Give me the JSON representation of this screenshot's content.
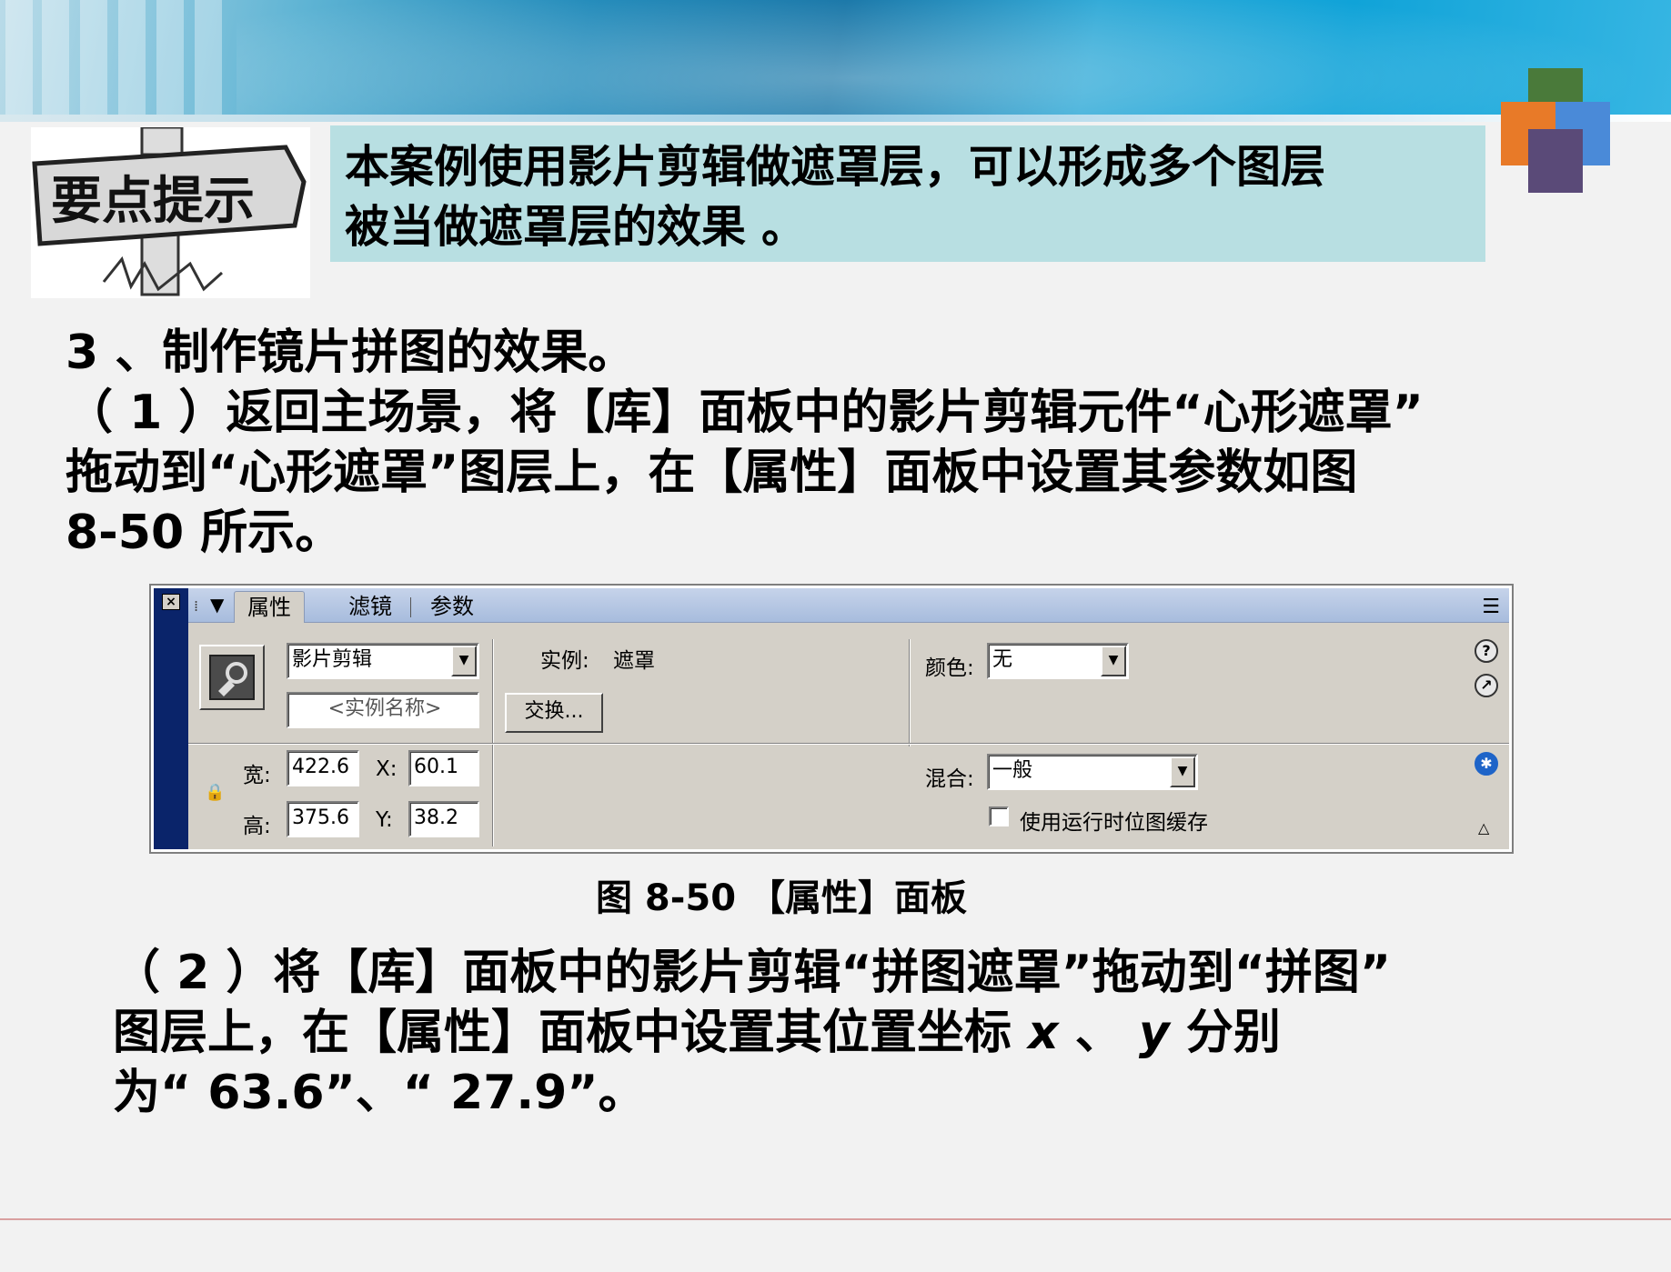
{
  "colors": {
    "tip_box_bg": "#b8dfe2",
    "page_bg": "#f2f2f2",
    "panel_bg": "#d4d0c8",
    "panel_side": "#0a246a",
    "footer_rule": "#d9a0a0"
  },
  "tip": {
    "sign_text": "要点提示",
    "lines": [
      "本案例使用影片剪辑做遮罩层，可以形成多个图层",
      "被当做遮罩层的效果 。"
    ]
  },
  "step": {
    "heading": "3 、制作镜片拼图的效果。",
    "item1_lines": [
      "（ 1 ）返回主场景，将【库】面板中的影片剪辑元件“心形遮罩”",
      "拖动到“心形遮罩”图层上，在【属性】面板中设置其参数如图",
      "8-50 所示。"
    ],
    "item2_lines": {
      "line1": "（ 2 ）将【库】面板中的影片剪辑“拼图遮罩”拖动到“拼图”",
      "line2_pre": "图层上，在【属性】面板中设置其位置坐标 ",
      "line2_x": "x",
      "line2_mid": " 、 ",
      "line2_y": "y",
      "line2_post": " 分别",
      "line3": "为“ 63.6”、“ 27.9”。"
    }
  },
  "panel": {
    "close_glyph": "×",
    "grip_glyph": "⁞",
    "collapse_glyph": "▼",
    "tabs": [
      {
        "label": "属性"
      },
      {
        "label": "滤镜"
      },
      {
        "label": "参数"
      }
    ],
    "options_glyph": "☰",
    "symbol_type": "影片剪辑",
    "instance_name_placeholder": "<实例名称>",
    "instance_label": "实例:",
    "instance_value": "遮罩",
    "swap_button": "交换...",
    "color_label": "颜色:",
    "color_value": "无",
    "blend_label": "混合:",
    "blend_value": "一般",
    "cache_label": "使用运行时位图缓存",
    "width_label": "宽:",
    "width_value": "422.6",
    "height_label": "高:",
    "height_value": "375.6",
    "x_label": "X:",
    "x_value": "60.1",
    "y_label": "Y:",
    "y_value": "38.2",
    "help_glyph": "?",
    "edit_glyph": "↗",
    "access_glyph": "✱",
    "expand_glyph": "△",
    "lock_glyph": "🔒",
    "dropdown_glyph": "▼"
  },
  "caption": "图 8-50 【属性】面板"
}
